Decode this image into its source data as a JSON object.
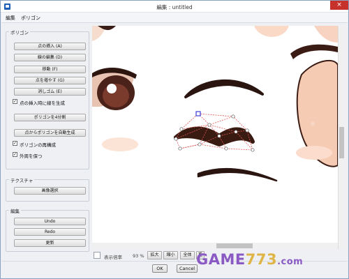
{
  "window": {
    "title": "編集 : untitled",
    "close_icon": "×"
  },
  "menu": {
    "items": [
      "編集",
      "ポリゴン"
    ]
  },
  "polygon_group": {
    "label": "ポリゴン",
    "buttons": [
      "点の挿入 (A)",
      "線の編集 (D)",
      "移動 (F)",
      "点を増やす (G)",
      "消しゴム (E)"
    ],
    "auto_line_checkbox": {
      "label": "点の挿入時に線を生成",
      "checked": true
    },
    "split_button": "ポリゴンを4分割",
    "auto_polygon_button": "点からポリゴンを自動生成",
    "reconstruct_checkbox": {
      "label": "ポリゴンの再構成",
      "checked": true
    },
    "keep_outline_checkbox": {
      "label": "外周を保つ",
      "checked": true
    }
  },
  "texture_group": {
    "label": "テクスチャ",
    "select_image_button": "画像選択"
  },
  "edit_group": {
    "label": "編集",
    "undo_button": "Undo",
    "redo_button": "Redo",
    "update_button": "更新"
  },
  "status": {
    "zoom_label": "表示倍率",
    "zoom_value": "93 %",
    "zoom_in_button": "拡大",
    "zoom_out_button": "縮小",
    "fit_button": "全体",
    "overlap_button": "重"
  },
  "dialog": {
    "ok_button": "OK",
    "cancel_button": "Cancel"
  },
  "watermark": {
    "brand_a": "GAME",
    "brand_b": "773",
    "brand_c": ".com"
  },
  "colors": {
    "accent": "#1f5fb8",
    "close": "#c7312b",
    "polygon_guide": "#e25555",
    "vertex_selected": "#3d3dd6",
    "watermark": "#8a59c4"
  }
}
